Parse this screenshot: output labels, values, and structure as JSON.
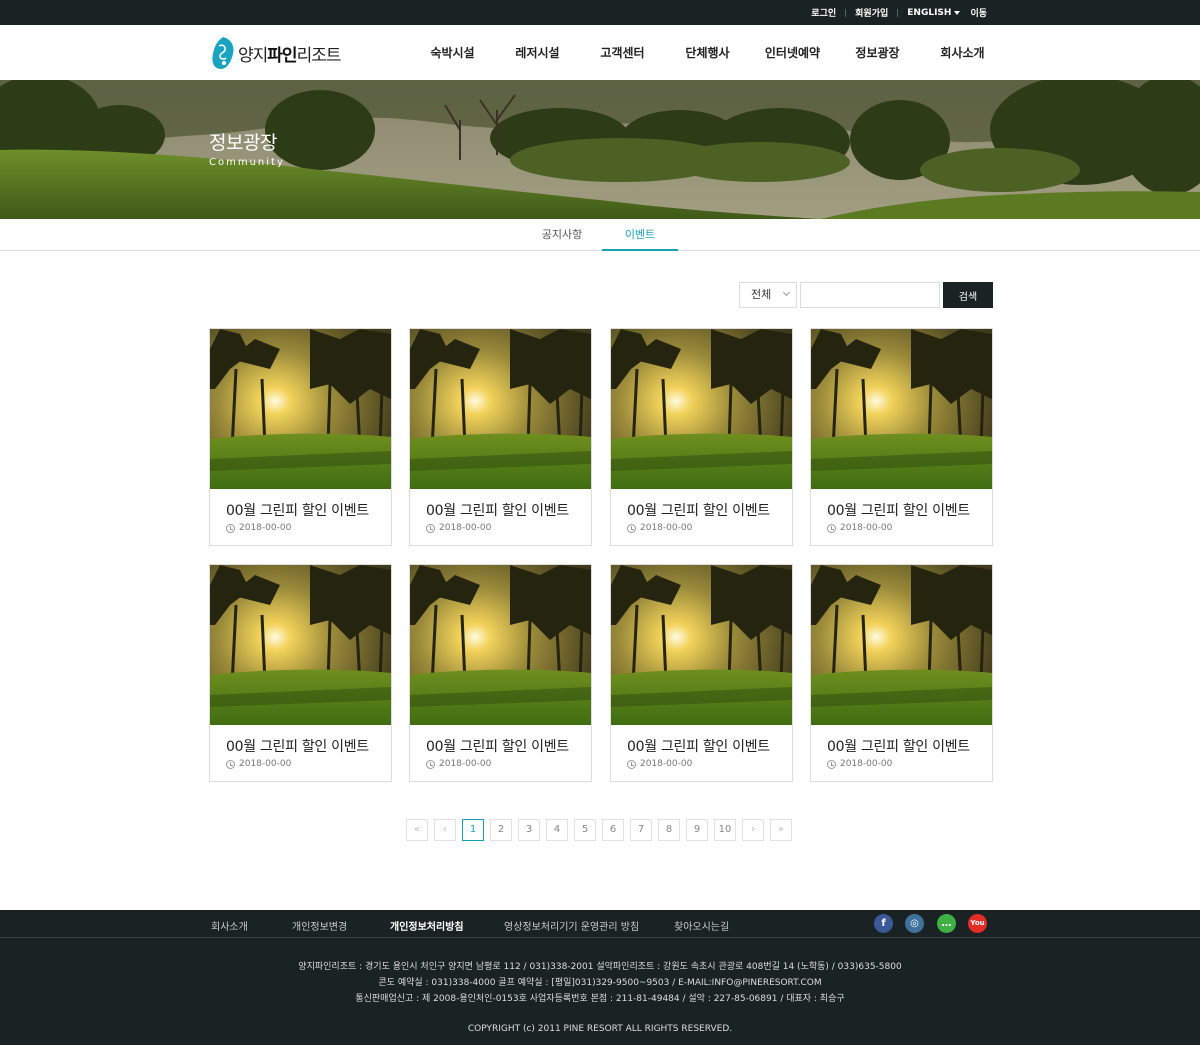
{
  "topbar": {
    "login": "로그인",
    "signup": "회원가입",
    "language": "ENGLISH",
    "go": "이동"
  },
  "logo": {
    "prefix": "양지",
    "bold": "파인",
    "suffix": "리조트"
  },
  "nav": [
    {
      "label": "숙박시설"
    },
    {
      "label": "레저시설"
    },
    {
      "label": "고객센터"
    },
    {
      "label": "단체행사"
    },
    {
      "label": "인터넷예약"
    },
    {
      "label": "정보광장"
    },
    {
      "label": "회사소개"
    }
  ],
  "hero": {
    "title": "정보광장",
    "subtitle": "Community"
  },
  "tabs": [
    {
      "label": "공지사항"
    },
    {
      "label": "이벤트"
    }
  ],
  "search": {
    "select_value": "전체",
    "input_value": "",
    "button_label": "검색"
  },
  "events": [
    {
      "title": "00월 그린피 할인 이벤트",
      "date": "2018-00-00"
    },
    {
      "title": "00월 그린피 할인 이벤트",
      "date": "2018-00-00"
    },
    {
      "title": "00월 그린피 할인 이벤트",
      "date": "2018-00-00"
    },
    {
      "title": "00월 그린피 할인 이벤트",
      "date": "2018-00-00"
    },
    {
      "title": "00월 그린피 할인 이벤트",
      "date": "2018-00-00"
    },
    {
      "title": "00월 그린피 할인 이벤트",
      "date": "2018-00-00"
    },
    {
      "title": "00월 그린피 할인 이벤트",
      "date": "2018-00-00"
    },
    {
      "title": "00월 그린피 할인 이벤트",
      "date": "2018-00-00"
    }
  ],
  "pagination": {
    "first": "«",
    "prev": "‹",
    "pages": [
      "1",
      "2",
      "3",
      "4",
      "5",
      "6",
      "7",
      "8",
      "9",
      "10"
    ],
    "current": "1",
    "next": "›",
    "last": "»"
  },
  "footer": {
    "links": [
      {
        "label": "회사소개"
      },
      {
        "label": "개인정보변경"
      },
      {
        "label": "개인정보처리방침"
      },
      {
        "label": "영상정보처리기기 운영관리 방침"
      },
      {
        "label": "찾아오시는길"
      }
    ],
    "sns": [
      {
        "icon": "facebook-icon",
        "glyph": "f",
        "color": "#3b5998"
      },
      {
        "icon": "instagram-icon",
        "glyph": "◎",
        "color": "#3f729b"
      },
      {
        "icon": "talk-icon",
        "glyph": "…",
        "color": "#3db144"
      },
      {
        "icon": "youtube-icon",
        "glyph": "You",
        "color": "#e52d27"
      }
    ],
    "info_line1": "양지파인리조트 : 경기도 용인시 처인구 양지면 남평로 112 / 031)338-2001    설악파인리조트 : 강원도 속초시 관광로 408번길 14 (노학동) / 033)635-5800",
    "info_line2": "콘도 예약실 : 031)338-4000    골프 예약실 : [평일]031)329-9500~9503 / E-MAIL:INFO@PINERESORT.COM",
    "info_line3": "통신판매업신고 : 제 2008-용인처인-0153호    사업자등록번호 본점 : 211-81-49484 / 설악 : 227-85-06891 / 대표자 : 최승구",
    "copyright": "COPYRIGHT (c) 2011 PINE RESORT ALL RIGHTS RESERVED."
  },
  "colors": {
    "accent": "#18a2b8",
    "dark": "#1b2223"
  }
}
